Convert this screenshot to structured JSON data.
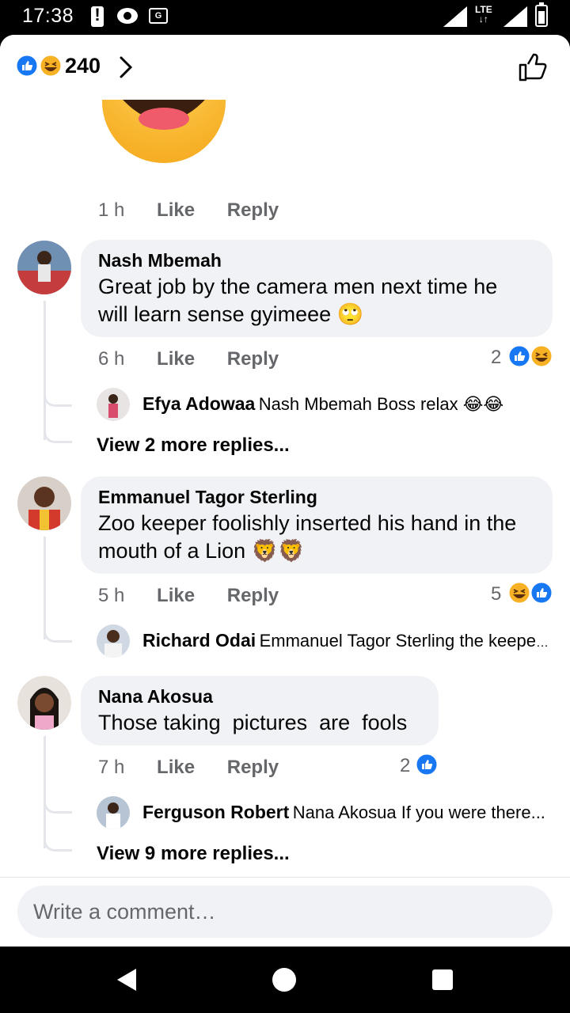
{
  "status_bar": {
    "time": "17:38",
    "network": "LTE"
  },
  "reactions_header": {
    "count": "240"
  },
  "sticker_meta": {
    "time": "1 h",
    "like": "Like",
    "reply": "Reply"
  },
  "comments": [
    {
      "name": "Nash Mbemah",
      "text_line1": "Great job by the camera men next time he",
      "text_line2": "will learn sense gyimeee 🙄",
      "time": "6 h",
      "like": "Like",
      "reply": "Reply",
      "reactions": "2",
      "reply_preview": {
        "name": "Efya Adowaa",
        "text": "Nash Mbemah Boss relax 😂😂"
      },
      "more_replies": "View 2 more replies..."
    },
    {
      "name": "Emmanuel Tagor Sterling",
      "text_line1": "Zoo keeper foolishly inserted his hand in the",
      "text_line2": "mouth of a Lion 🦁🦁",
      "time": "5 h",
      "like": "Like",
      "reply": "Reply",
      "reactions": "5",
      "reply_preview": {
        "name": "Richard Odai",
        "text": "Emmanuel Tagor Sterling the keeper..."
      }
    },
    {
      "name": "Nana Akosua",
      "text_line1": "Those taking  pictures  are  fools",
      "time": "7 h",
      "like": "Like",
      "reply": "Reply",
      "reactions": "2",
      "reply_preview": {
        "name": "Ferguson Robert",
        "text": "Nana Akosua If you were there..."
      },
      "more_replies": "View 9 more replies..."
    }
  ],
  "composer": {
    "placeholder": "Write a comment…"
  },
  "colors": {
    "like_blue": "#1877f2",
    "haha_yellow": "#f7b125",
    "bubble_bg": "#f0f2f5",
    "meta_gray": "#65676b"
  }
}
